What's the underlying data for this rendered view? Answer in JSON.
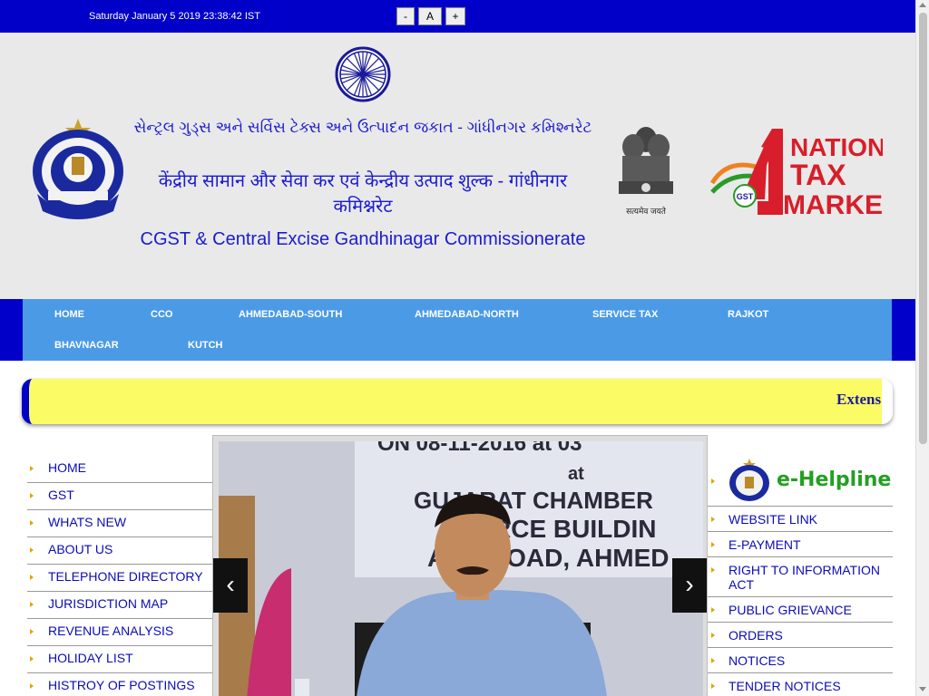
{
  "topbar": {
    "datetime": "Saturday January 5 2019 23:38:42 IST",
    "font_decrease": "-",
    "font_normal": "A",
    "font_increase": "+"
  },
  "header": {
    "title_gujarati": "સેન્ટ્રલ ગુડ્સ અને સર્વિસ ટેક્સ અને ઉત્પાદન જકાત - ગાંધીનગર કમિશ્નરેટ",
    "title_hindi": "केंद्रीय सामान और सेवा कर एवं केन्द्रीय उत्पाद शुल्क - गांधीनगर कमिश्नरेट",
    "title_english": "CGST & Central Excise Gandhinagar Commissionerate",
    "emblem_motto": "सत्यमेव जयते",
    "gst_logo_line1": "NATION",
    "gst_logo_line2": "TAX",
    "gst_logo_line3": "MARKET",
    "gst_logo_digit": "1",
    "gst_logo_badge": "GST"
  },
  "nav": {
    "items": [
      "HOME",
      "CCO",
      "AHMEDABAD-SOUTH",
      "AHMEDABAD-NORTH",
      "SERVICE TAX",
      "RAJKOT",
      "BHAVNAGAR",
      "KUTCH"
    ]
  },
  "marquee": {
    "text": "Extens"
  },
  "left_menu": {
    "items": [
      "HOME",
      "GST",
      "WHATS NEW",
      "ABOUT US",
      "TELEPHONE DIRECTORY",
      "JURISDICTION MAP",
      "REVENUE ANALYSIS",
      "HOLIDAY LIST",
      "HISTROY OF POSTINGS"
    ]
  },
  "slider": {
    "banner_line1": "ON 08-11-2016 at 03",
    "banner_line2": "at",
    "banner_line3": "GUJARAT CHAMBER",
    "banner_line4": "MERCE BUILDIN",
    "banner_line5": "ASH  ROAD, AHMED",
    "prev_label": "‹",
    "next_label": "›"
  },
  "right_menu": {
    "ehelpline": "e-Helpline",
    "items": [
      "WEBSITE LINK",
      "E-PAYMENT",
      "RIGHT TO INFORMATION ACT",
      "PUBLIC GRIEVANCE",
      "ORDERS",
      "NOTICES",
      "TENDER NOTICES"
    ]
  },
  "colors": {
    "topbar": "#0000c8",
    "nav": "#4b9ae6",
    "link": "#0b0bb8",
    "marquee_bg": "#fbfb66"
  }
}
